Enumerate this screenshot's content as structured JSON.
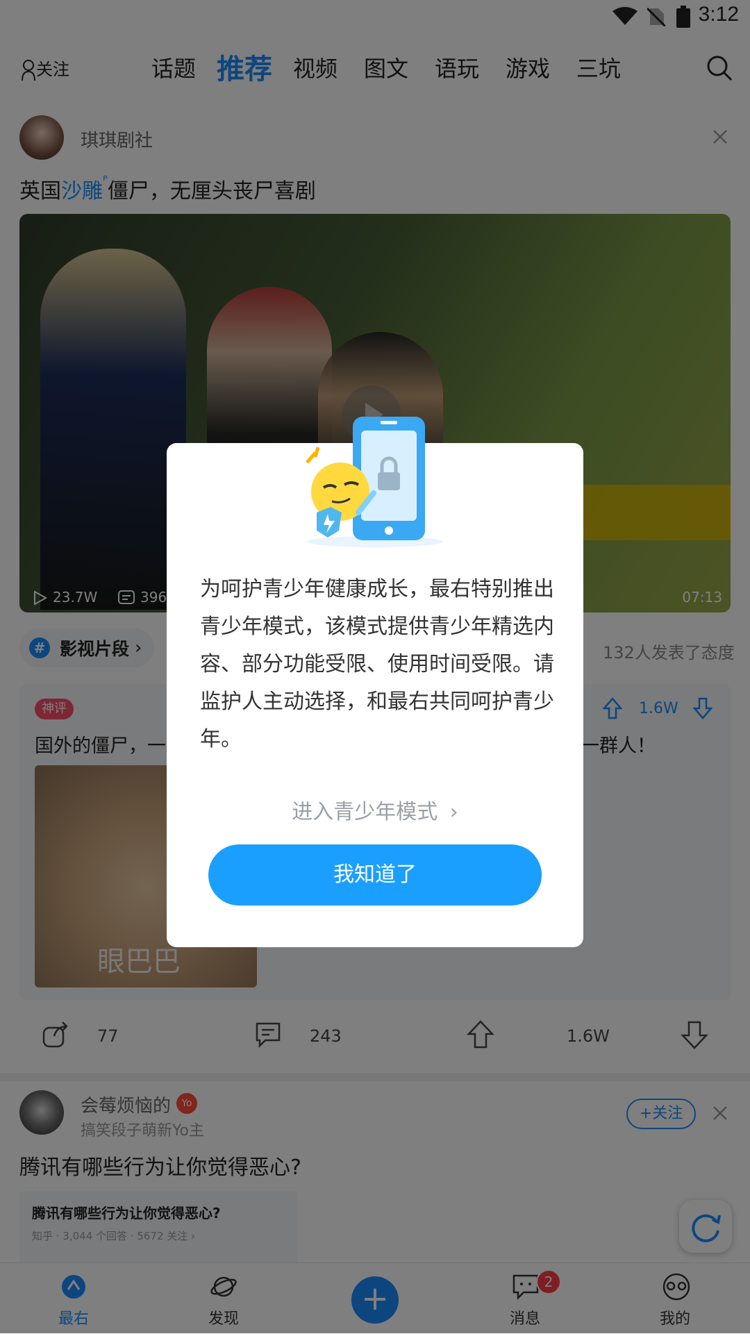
{
  "status_bar": {
    "time": "3:12"
  },
  "top_nav": {
    "follow_label": "关注",
    "tabs": [
      "话题",
      "推荐",
      "视频",
      "图文",
      "语玩",
      "游戏",
      "三坑"
    ],
    "active_tab": "推荐"
  },
  "post1": {
    "author": "琪琪剧社",
    "title_prefix": "英国",
    "title_link": "沙雕",
    "title_suffix": "僵尸，无厘头丧尸喜剧",
    "video_plays": "23.7W",
    "video_comments": "396",
    "video_duration": "07:13",
    "topic": "影视片段",
    "attitude_count": "132人发表了态度"
  },
  "hot_comment": {
    "badge": "神评",
    "text_left": "国外的僵尸，一",
    "text_right": "一群人！",
    "upvotes": "1.6W",
    "image_caption": "眼巴巴"
  },
  "action_bar": {
    "shares": "77",
    "comments": "243",
    "likes": "1.6W"
  },
  "post2": {
    "author": "会莓烦恼的",
    "author_badge": "Yo",
    "author_desc": "搞笑段子萌新Yo主",
    "follow_btn": "+关注",
    "title": "腾讯有哪些行为让你觉得恶心?",
    "quote_title": "腾讯有哪些行为让你觉得恶心?",
    "quote_meta": "知乎 · 3,044 个回答 · 5672 关注 ›"
  },
  "tab_bar": {
    "items": [
      "最右",
      "发现",
      "消息",
      "我的"
    ],
    "message_badge": "2"
  },
  "dialog": {
    "body": "为呵护青少年健康成长，最右特别推出青少年模式，该模式提供青少年精选内容、部分功能受限、使用时间受限。请监护人主动选择，和最右共同呵护青少年。",
    "teen_mode_link": "进入青少年模式",
    "confirm_button": "我知道了"
  },
  "colors": {
    "accent": "#1a8cff",
    "button": "#1a9fff",
    "badge_red": "#ff3b4a"
  }
}
